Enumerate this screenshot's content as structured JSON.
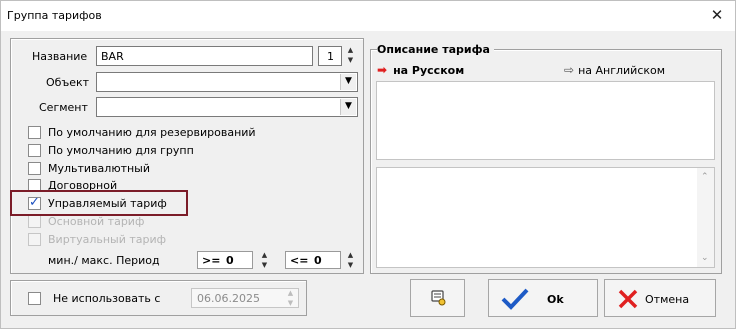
{
  "window": {
    "title": "Группа тарифов",
    "close_glyph": "✕"
  },
  "form": {
    "name_label": "Название",
    "name_value": "BAR",
    "name_number": "1",
    "object_label": "Объект",
    "object_value": "",
    "segment_label": "Сегмент",
    "segment_value": ""
  },
  "checkboxes": [
    {
      "label": "По умолчанию для резервирований",
      "checked": false,
      "disabled": false
    },
    {
      "label": "По умолчанию для групп",
      "checked": false,
      "disabled": false
    },
    {
      "label": "Мультивалютный",
      "checked": false,
      "disabled": false
    },
    {
      "label": "Договорной",
      "checked": false,
      "disabled": false
    },
    {
      "label": "Управляемый тариф",
      "checked": true,
      "disabled": false
    },
    {
      "label": "Основной тариф",
      "checked": false,
      "disabled": true
    },
    {
      "label": "Виртуальный тариф",
      "checked": false,
      "disabled": true
    }
  ],
  "period": {
    "label": "мин./ макс. Период",
    "min_op": ">=",
    "min_value": "0",
    "max_op": "<=",
    "max_value": "0"
  },
  "description": {
    "header": "Описание тарифа",
    "tab_ru": "на Русском",
    "tab_en": "на Английском",
    "ru_text": "",
    "en_text": ""
  },
  "footer": {
    "not_use_label": "Не использовать с",
    "not_use_checked": false,
    "date_value": "06.06.2025"
  },
  "buttons": {
    "ok_label": "Ok",
    "cancel_label": "Отмена"
  },
  "colors": {
    "accent_red": "#e02020",
    "check_blue": "#1a4fbf",
    "highlight": "#7b1c28",
    "ok_blue": "#1e5bc6"
  }
}
